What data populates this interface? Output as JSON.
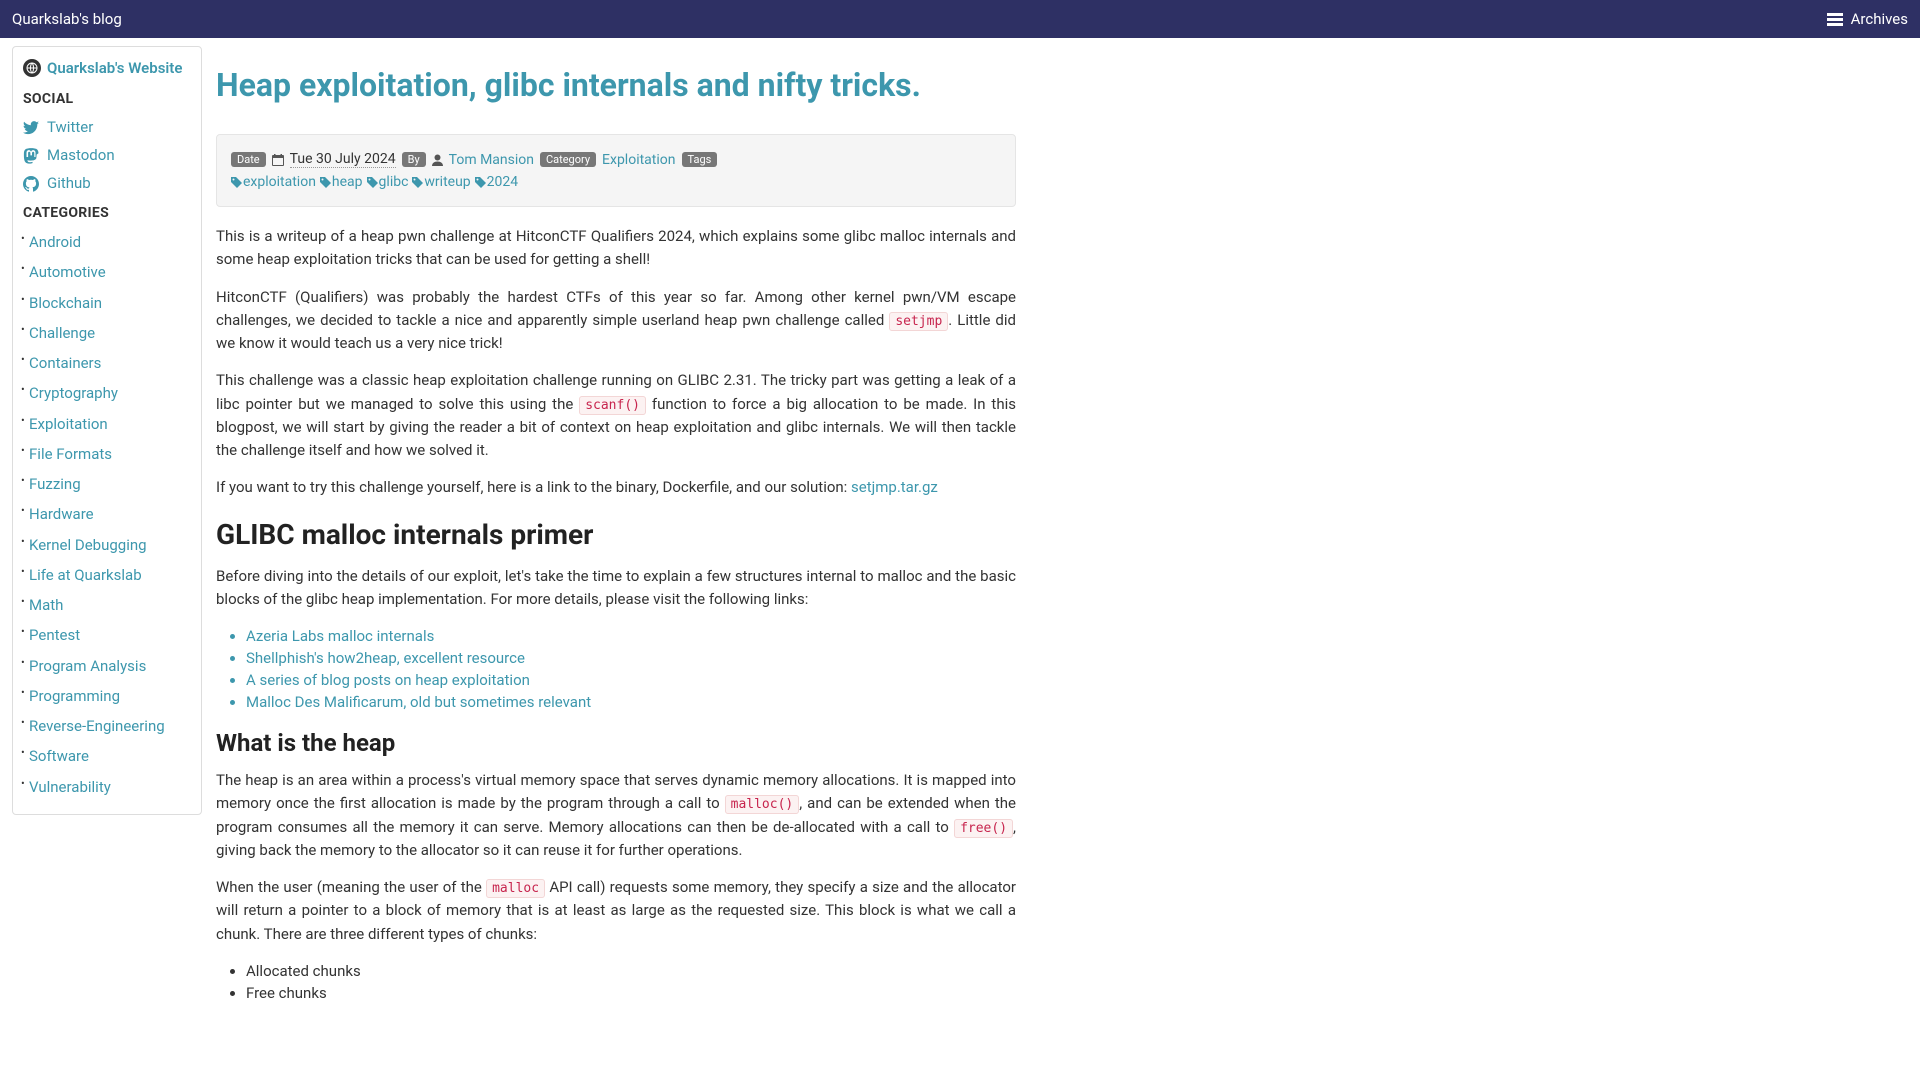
{
  "topbar": {
    "brand": "Quarkslab's blog",
    "archives": "Archives"
  },
  "sidebar": {
    "website_link": "Quarkslab's Website",
    "social_header": "SOCIAL",
    "social": [
      {
        "label": "Twitter",
        "icon": "twitter"
      },
      {
        "label": "Mastodon",
        "icon": "mastodon"
      },
      {
        "label": "Github",
        "icon": "github"
      }
    ],
    "categories_header": "CATEGORIES",
    "categories": [
      "Android",
      "Automotive",
      "Blockchain",
      "Challenge",
      "Containers",
      "Cryptography",
      "Exploitation",
      "File Formats",
      "Fuzzing",
      "Hardware",
      "Kernel Debugging",
      "Life at Quarkslab",
      "Math",
      "Pentest",
      "Program Analysis",
      "Programming",
      "Reverse-Engineering",
      "Software",
      "Vulnerability"
    ]
  },
  "article": {
    "title": "Heap exploitation, glibc internals and nifty tricks.",
    "meta": {
      "date_label": "Date",
      "date": "Tue 30 July 2024",
      "by_label": "By",
      "author": "Tom Mansion",
      "category_label": "Category",
      "category": "Exploitation",
      "tags_label": "Tags",
      "tags": [
        "exploitation",
        "heap",
        "glibc",
        "writeup",
        "2024"
      ]
    },
    "p1": "This is a writeup of a heap pwn challenge at HitconCTF Qualifiers 2024, which explains some glibc malloc internals and some heap exploitation tricks that can be used for getting a shell!",
    "p2a": "HitconCTF (Qualifiers) was probably the hardest CTFs of this year so far. Among other kernel pwn/VM escape challenges, we decided to tackle a nice and apparently simple userland heap pwn challenge called ",
    "p2_code": "setjmp",
    "p2b": ". Little did we know it would teach us a very nice trick!",
    "p3a": "This challenge was a classic heap exploitation challenge running on GLIBC 2.31. The tricky part was getting a leak of a libc pointer but we managed to solve this using the ",
    "p3_code": "scanf()",
    "p3b": " function to force a big allocation to be made. In this blogpost, we will start by giving the reader a bit of context on heap exploitation and glibc internals. We will then tackle the challenge itself and how we solved it.",
    "p4a": "If you want to try this challenge yourself, here is a link to the binary, Dockerfile, and our solution: ",
    "p4_link": "setjmp.tar.gz",
    "h2_primer": "GLIBC malloc internals primer",
    "p5": "Before diving into the details of our exploit, let's take the time to explain a few structures internal to malloc and the basic blocks of the glibc heap implementation. For more details, please visit the following links:",
    "links": [
      "Azeria Labs malloc internals",
      "Shellphish's how2heap, excellent resource",
      "A series of blog posts on heap exploitation",
      "Malloc Des Malificarum, old but sometimes relevant"
    ],
    "h3_whatis": "What is the heap",
    "p6a": "The heap is an area within a process's virtual memory space that serves dynamic memory allocations. It is mapped into memory once the first allocation is made by the program through a call to ",
    "p6_code1": "malloc()",
    "p6b": ", and can be extended when the program consumes all the memory it can serve. Memory allocations can then be de-allocated with a call to ",
    "p6_code2": "free()",
    "p6c": ", giving back the memory to the allocator so it can reuse it for further operations.",
    "p7a": "When the user (meaning the user of the ",
    "p7_code": "malloc",
    "p7b": " API call) requests some memory, they specify a size and the allocator will return a pointer to a block of memory that is at least as large as the requested size. This block is what we call a chunk. There are three different types of chunks:",
    "chunks": [
      "Allocated chunks",
      "Free chunks"
    ]
  }
}
